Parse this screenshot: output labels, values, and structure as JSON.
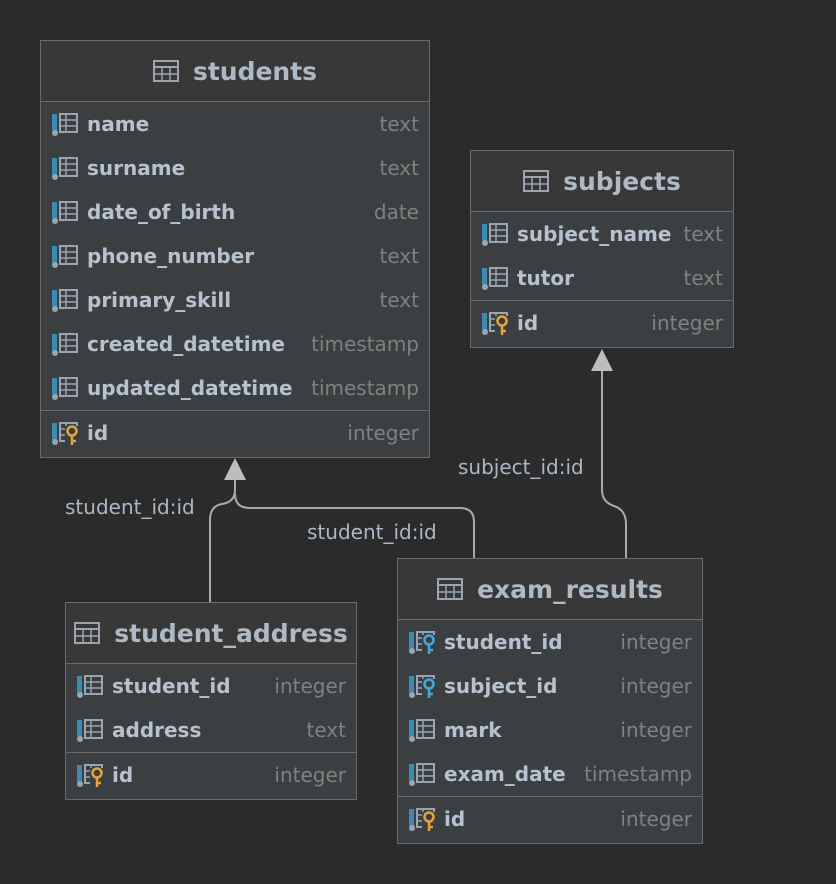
{
  "colors": {
    "background": "#2b2b2b",
    "entity_fill": "#3c3f41",
    "entity_border": "#6a6a6a",
    "title_text": "#aeb9c6",
    "column_text": "#b6c3cf",
    "type_text": "#808080",
    "column_marker": "#3b8bb0",
    "pk_key": "#e6a23c",
    "fk_key": "#3fa9e0",
    "connector": "#aaaaaa"
  },
  "entities": {
    "students": {
      "title": "students",
      "columns": [
        {
          "name": "name",
          "type": "text",
          "icon": "column-icon"
        },
        {
          "name": "surname",
          "type": "text",
          "icon": "column-icon"
        },
        {
          "name": "date_of_birth",
          "type": "date",
          "icon": "column-icon"
        },
        {
          "name": "phone_number",
          "type": "text",
          "icon": "column-icon"
        },
        {
          "name": "primary_skill",
          "type": "text",
          "icon": "column-icon"
        },
        {
          "name": "created_datetime",
          "type": "timestamp",
          "icon": "column-icon"
        },
        {
          "name": "updated_datetime",
          "type": "timestamp",
          "icon": "column-icon"
        }
      ],
      "keys": [
        {
          "name": "id",
          "type": "integer",
          "icon": "primary-key-icon"
        }
      ]
    },
    "subjects": {
      "title": "subjects",
      "columns": [
        {
          "name": "subject_name",
          "type": "text",
          "icon": "column-icon"
        },
        {
          "name": "tutor",
          "type": "text",
          "icon": "column-icon"
        }
      ],
      "keys": [
        {
          "name": "id",
          "type": "integer",
          "icon": "primary-key-icon"
        }
      ]
    },
    "student_address": {
      "title": "student_address",
      "columns": [
        {
          "name": "student_id",
          "type": "integer",
          "icon": "column-icon"
        },
        {
          "name": "address",
          "type": "text",
          "icon": "column-icon"
        }
      ],
      "keys": [
        {
          "name": "id",
          "type": "integer",
          "icon": "primary-key-icon"
        }
      ]
    },
    "exam_results": {
      "title": "exam_results",
      "columns": [
        {
          "name": "student_id",
          "type": "integer",
          "icon": "foreign-key-icon"
        },
        {
          "name": "subject_id",
          "type": "integer",
          "icon": "foreign-key-icon"
        },
        {
          "name": "mark",
          "type": "integer",
          "icon": "column-icon"
        },
        {
          "name": "exam_date",
          "type": "timestamp",
          "icon": "column-icon"
        }
      ],
      "keys": [
        {
          "name": "id",
          "type": "integer",
          "icon": "primary-key-icon"
        }
      ]
    }
  },
  "relations": [
    {
      "label": "student_id:id",
      "from": "student_address",
      "to": "students"
    },
    {
      "label": "student_id:id",
      "from": "exam_results",
      "to": "students"
    },
    {
      "label": "subject_id:id",
      "from": "exam_results",
      "to": "subjects"
    }
  ]
}
